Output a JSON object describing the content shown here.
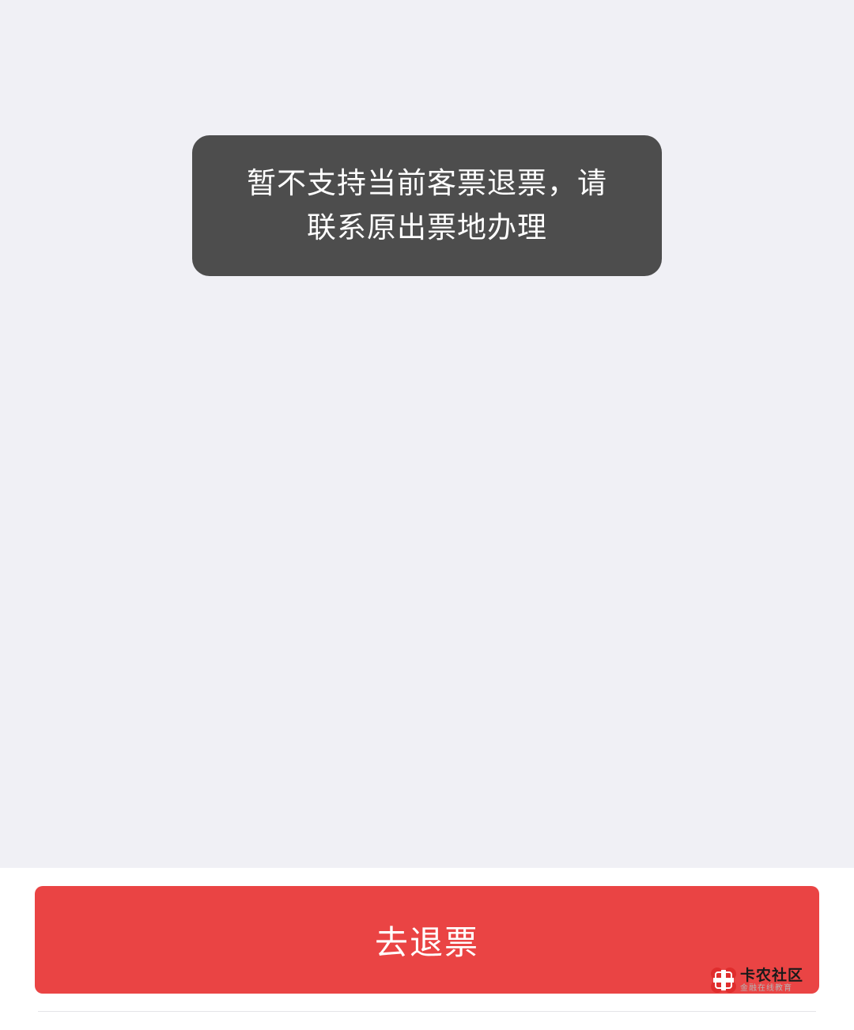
{
  "toast": {
    "line1": "暂不支持当前客票退票，请",
    "line2": "联系原出票地办理"
  },
  "footer": {
    "button_label": "去退票"
  },
  "watermark": {
    "title": "卡农社区",
    "subtitle": "金融在线教育",
    "logo_icon": "kanong-logo-icon"
  },
  "colors": {
    "background": "#f0f0f5",
    "toast_background": "#4d4d4d",
    "button": "#ea4444",
    "footer_background": "#ffffff"
  }
}
